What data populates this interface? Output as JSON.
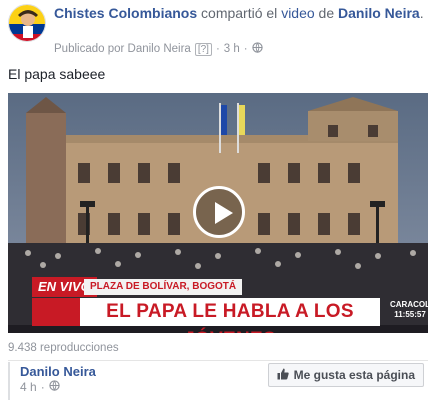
{
  "post": {
    "page_name": "Chistes Colombianos",
    "shared_text": "compartió el",
    "video_word": "video",
    "de_text": "de",
    "author_name": "Danilo Neira",
    "period": ".",
    "published_by": "Publicado por Danilo Neira",
    "help_badge": "[?]",
    "separator": "·",
    "time": "3 h",
    "caption": "El papa sabeee"
  },
  "video": {
    "live_label": "EN VIVO",
    "location_label": "PLAZA DE BOLÍVAR, BOGOTÁ",
    "headline": "EL PAPA LE HABLA A LOS JÓVENES",
    "channel_bug": "CARACOL",
    "clock": "11:55:57"
  },
  "stats": {
    "views": "9.438 reproducciones"
  },
  "page_card": {
    "name": "Danilo Neira",
    "time": "4 h",
    "separator": "·",
    "like_label": "Me gusta esta página"
  },
  "colors": {
    "link": "#365899",
    "news_red": "#c81a25"
  }
}
